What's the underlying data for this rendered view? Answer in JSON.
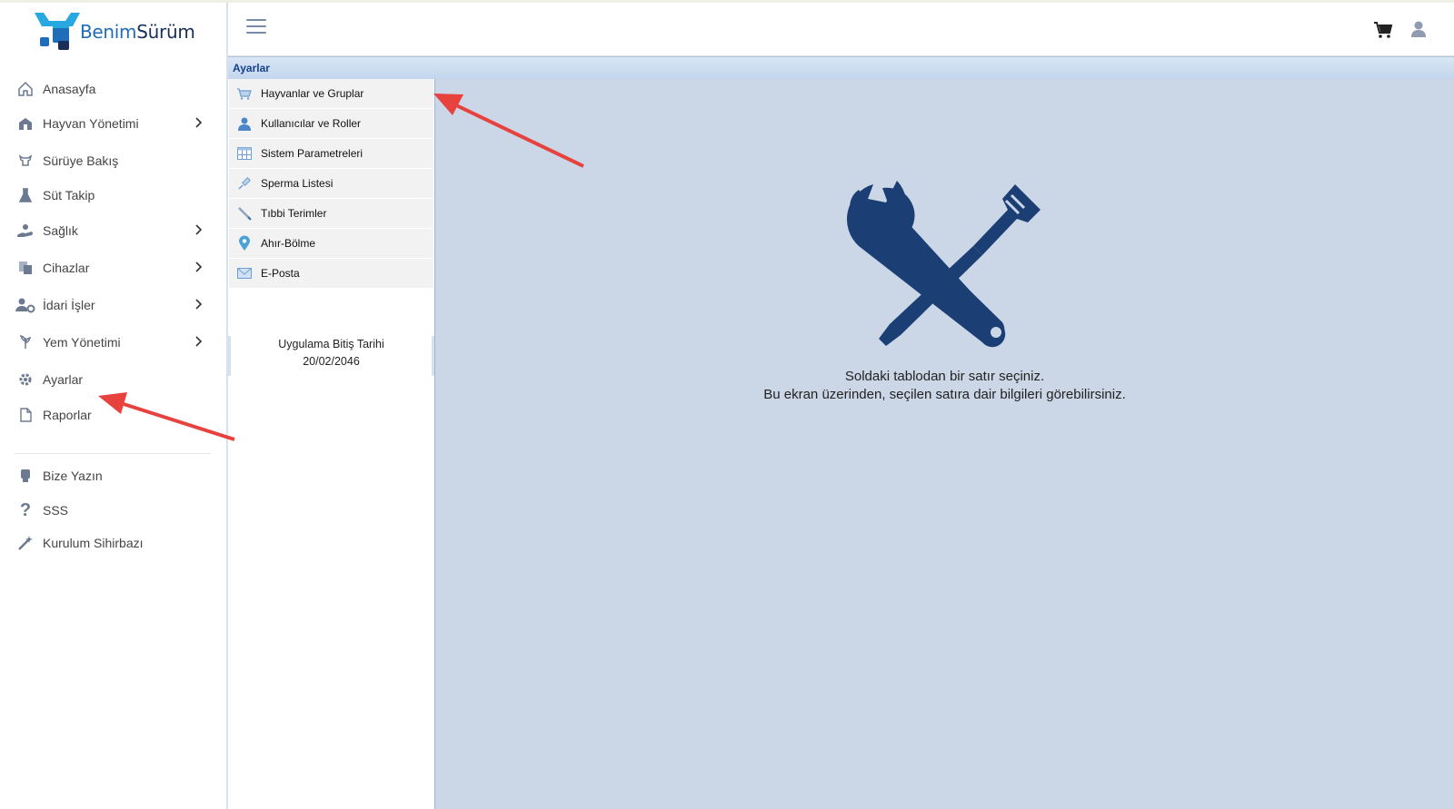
{
  "brand": {
    "name_part1": "Benim",
    "name_part2": "Sürüm"
  },
  "sidebar": {
    "items": [
      {
        "label": "Anasayfa",
        "icon": "home-icon"
      },
      {
        "label": "Hayvan Yönetimi",
        "icon": "barn-icon",
        "has_submenu": true
      },
      {
        "label": "Sürüye Bakış",
        "icon": "cow-icon"
      },
      {
        "label": "Süt Takip",
        "icon": "flask-icon"
      },
      {
        "label": "Sağlık",
        "icon": "health-icon",
        "has_submenu": true
      },
      {
        "label": "Cihazlar",
        "icon": "devices-icon",
        "has_submenu": true
      },
      {
        "label": "İdari İşler",
        "icon": "users-gear-icon",
        "has_submenu": true
      },
      {
        "label": "Yem Yönetimi",
        "icon": "feed-icon",
        "has_submenu": true
      },
      {
        "label": "Ayarlar",
        "icon": "gear-icon"
      },
      {
        "label": "Raporlar",
        "icon": "document-icon"
      },
      {
        "label": "Bize Yazın",
        "icon": "contact-icon"
      },
      {
        "label": "SSS",
        "icon": "question-icon"
      },
      {
        "label": "Kurulum Sihirbazı",
        "icon": "magic-wand-icon"
      }
    ]
  },
  "header": {
    "menu_icon": "hamburger-icon",
    "cart_icon": "cart-icon",
    "user_icon": "user-icon"
  },
  "settings": {
    "title": "Ayarlar",
    "items": [
      {
        "label": "Hayvanlar ve Gruplar",
        "icon": "cart-icon"
      },
      {
        "label": "Kullanıcılar ve Roller",
        "icon": "user-icon"
      },
      {
        "label": "Sistem Parametreleri",
        "icon": "table-icon"
      },
      {
        "label": "Sperma Listesi",
        "icon": "syringe-icon"
      },
      {
        "label": "Tıbbi Terimler",
        "icon": "pen-icon"
      },
      {
        "label": "Ahır-Bölme",
        "icon": "map-pin-icon"
      },
      {
        "label": "E-Posta",
        "icon": "mail-icon"
      }
    ],
    "expiry_label": "Uygulama Bitiş Tarihi",
    "expiry_date": "20/02/2046",
    "empty_line1": "Soldaki tablodan bir satır seçiniz.",
    "empty_line2": "Bu ekran üzerinden, seçilen satıra dair bilgileri görebilirsiniz."
  },
  "colors": {
    "accent": "#1f6db8",
    "panel_bg": "#cbd7e6",
    "tools_icon": "#1b3f74",
    "arrow": "#e8423f"
  }
}
